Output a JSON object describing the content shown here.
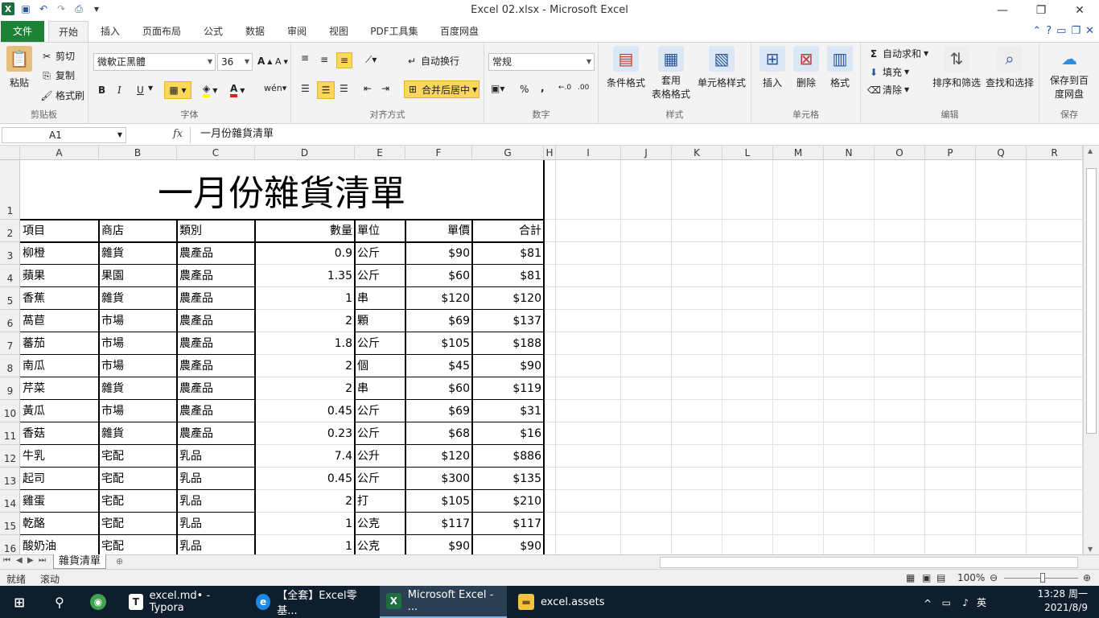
{
  "window": {
    "title": "Excel 02.xlsx  -  Microsoft Excel",
    "minimize_icon": "minimize-icon",
    "restore_icon": "restore-icon",
    "close_icon": "close-icon"
  },
  "tabs": [
    "文件",
    "开始",
    "插入",
    "页面布局",
    "公式",
    "数据",
    "审阅",
    "视图",
    "PDF工具集",
    "百度网盘"
  ],
  "ribbon": {
    "clipboard": {
      "paste": "粘贴",
      "cut": "剪切",
      "copy": "复制",
      "format_painter": "格式刷",
      "label": "剪贴板"
    },
    "font": {
      "font_name": "微軟正黑體",
      "font_size": "36",
      "label": "字体"
    },
    "alignment": {
      "wrap": "自动换行",
      "merge": "合并后居中",
      "label": "对齐方式"
    },
    "number": {
      "format": "常规",
      "percent": "%",
      "comma": ",",
      "label": "数字"
    },
    "styles": {
      "conditional": "条件格式",
      "table_format_1": "套用",
      "table_format_2": "表格格式",
      "cell_styles": "单元格样式",
      "label": "样式"
    },
    "cells": {
      "insert": "插入",
      "delete": "删除",
      "format": "格式",
      "label": "单元格"
    },
    "editing": {
      "autosum": "自动求和",
      "fill": "填充",
      "clear": "清除",
      "sort": "排序和筛选",
      "find": "查找和选择",
      "label": "编辑"
    },
    "save": {
      "save1": "保存到百",
      "save2": "度网盘",
      "label": "保存"
    }
  },
  "formula_bar": {
    "name_box": "A1",
    "fx": "fx",
    "formula": "一月份雜貨清單"
  },
  "columns": [
    "A",
    "B",
    "C",
    "D",
    "E",
    "F",
    "G",
    "H",
    "I",
    "J",
    "K",
    "L",
    "M",
    "N",
    "O",
    "P",
    "Q",
    "R"
  ],
  "sheet": {
    "title": "一月份雜貨清單",
    "headers": [
      "項目",
      "商店",
      "類別",
      "數量",
      "單位",
      "單價",
      "合計"
    ],
    "rows": [
      [
        "柳橙",
        "雜貨",
        "農產品",
        "0.9",
        "公斤",
        "$90",
        "$81"
      ],
      [
        "蘋果",
        "果園",
        "農產品",
        "1.35",
        "公斤",
        "$60",
        "$81"
      ],
      [
        "香蕉",
        "雜貨",
        "農產品",
        "1",
        "串",
        "$120",
        "$120"
      ],
      [
        "萵苣",
        "市場",
        "農產品",
        "2",
        "顆",
        "$69",
        "$137"
      ],
      [
        "蕃茄",
        "市場",
        "農產品",
        "1.8",
        "公斤",
        "$105",
        "$188"
      ],
      [
        "南瓜",
        "市場",
        "農產品",
        "2",
        "個",
        "$45",
        "$90"
      ],
      [
        "芹菜",
        "雜貨",
        "農產品",
        "2",
        "串",
        "$60",
        "$119"
      ],
      [
        "黃瓜",
        "市場",
        "農產品",
        "0.45",
        "公斤",
        "$69",
        "$31"
      ],
      [
        "香菇",
        "雜貨",
        "農產品",
        "0.23",
        "公斤",
        "$68",
        "$16"
      ],
      [
        "牛乳",
        "宅配",
        "乳品",
        "7.4",
        "公升",
        "$120",
        "$886"
      ],
      [
        "起司",
        "宅配",
        "乳品",
        "0.45",
        "公斤",
        "$300",
        "$135"
      ],
      [
        "雞蛋",
        "宅配",
        "乳品",
        "2",
        "打",
        "$105",
        "$210"
      ],
      [
        "乾酪",
        "宅配",
        "乳品",
        "1",
        "公克",
        "$117",
        "$117"
      ],
      [
        "酸奶油",
        "宅配",
        "乳品",
        "1",
        "公克",
        "$90",
        "$90"
      ]
    ]
  },
  "sheet_tab": "雜貨清單",
  "status": {
    "ready": "就绪",
    "scroll": "滚动",
    "zoom": "100%"
  },
  "taskbar": {
    "typora": "excel.md• - Typora",
    "edge": "【全套】Excel零基...",
    "excel": "Microsoft Excel - ...",
    "folder": "excel.assets",
    "time": "13:28 周一",
    "date": "2021/8/9",
    "lang": "英"
  },
  "colors": {
    "file_tab": "#1d8136",
    "taskbar": "#0f1e2d",
    "highlight": "#fbd85c"
  }
}
